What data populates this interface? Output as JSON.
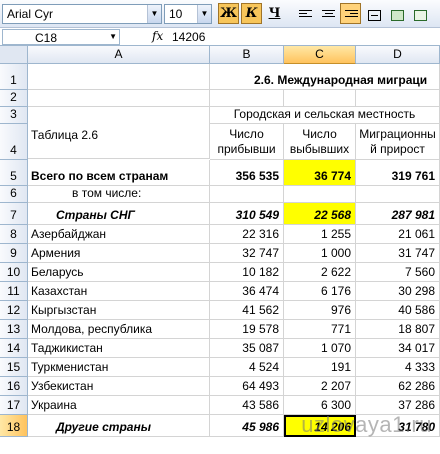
{
  "toolbar": {
    "font_name": "Arial Cyr",
    "font_size": "10",
    "bold_label": "Ж",
    "italic_label": "К",
    "underline_label": "Ч"
  },
  "formula_bar": {
    "name_box": "C18",
    "fx_label": "fx",
    "formula": "14206"
  },
  "columns": [
    "A",
    "B",
    "C",
    "D"
  ],
  "rows": [
    "1",
    "2",
    "3",
    "4",
    "5",
    "6",
    "7",
    "8",
    "9",
    "10",
    "11",
    "12",
    "13",
    "14",
    "15",
    "16",
    "17",
    "18"
  ],
  "sheet": {
    "title": "2.6. Международная миграци",
    "group_header": "Городская и сельская местность",
    "table_label": "Таблица 2.6",
    "col_b_header": "Число прибывши",
    "col_c_header": "Число выбывших",
    "col_d_header": "Миграционны й прирост",
    "total": {
      "label": "Всего по всем странам",
      "b": "356 535",
      "c": "36 774",
      "d": "319 761"
    },
    "including": "в том числе:",
    "cis": {
      "label": "Страны СНГ",
      "b": "310 549",
      "c": "22 568",
      "d": "287 981"
    },
    "countries": [
      {
        "label": "Азербайджан",
        "b": "22 316",
        "c": "1 255",
        "d": "21 061"
      },
      {
        "label": "Армения",
        "b": "32 747",
        "c": "1 000",
        "d": "31 747"
      },
      {
        "label": "Беларусь",
        "b": "10 182",
        "c": "2 622",
        "d": "7 560"
      },
      {
        "label": "Казахстан",
        "b": "36 474",
        "c": "6 176",
        "d": "30 298"
      },
      {
        "label": "Кыргызстан",
        "b": "41 562",
        "c": "976",
        "d": "40 586"
      },
      {
        "label": "Молдова, республика",
        "b": "19 578",
        "c": "771",
        "d": "18 807"
      },
      {
        "label": "Таджикистан",
        "b": "35 087",
        "c": "1 070",
        "d": "34 017"
      },
      {
        "label": "Туркменистан",
        "b": "4 524",
        "c": "191",
        "d": "4 333"
      },
      {
        "label": "Узбекистан",
        "b": "64 493",
        "c": "2 207",
        "d": "62 286"
      },
      {
        "label": "Украина",
        "b": "43 586",
        "c": "6 300",
        "d": "37 286"
      }
    ],
    "other": {
      "label": "Другие страны",
      "b": "45 986",
      "c": "14 206",
      "d": "31 780"
    }
  },
  "watermark": "uzlovaya1.ru",
  "colors": {
    "highlight": "#ffff00",
    "selection_header": "#ffc35e",
    "grid_line": "#d4d4d4"
  }
}
